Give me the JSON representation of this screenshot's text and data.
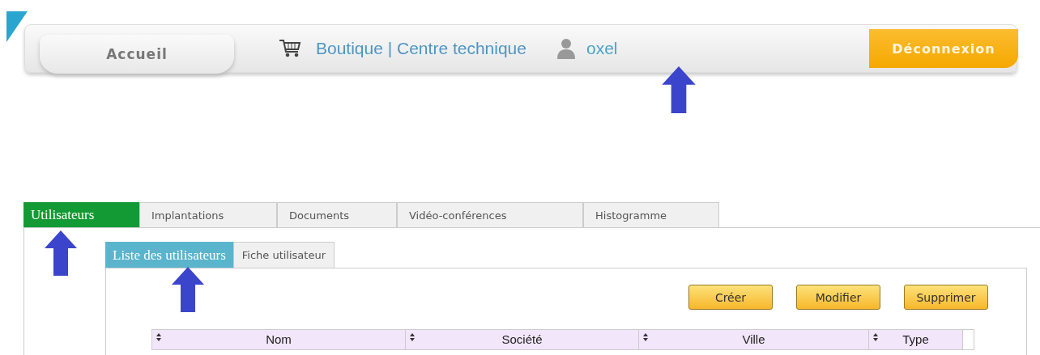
{
  "header": {
    "home": "Accueil",
    "shop": "Boutique | Centre technique",
    "user": "oxel",
    "logout": "Déconnexion"
  },
  "tabs": [
    {
      "label": "Utilisateurs",
      "selected": true
    },
    {
      "label": "Implantations",
      "selected": false
    },
    {
      "label": "Documents",
      "selected": false
    },
    {
      "label": "Vidéo-conférences",
      "selected": false
    },
    {
      "label": "Histogramme",
      "selected": false
    }
  ],
  "subtabs": [
    {
      "label": "Liste des utilisateurs",
      "selected": true
    },
    {
      "label": "Fiche utilisateur",
      "selected": false
    }
  ],
  "buttons": [
    "Créer",
    "Modifier",
    "Supprimer"
  ],
  "table": {
    "columns": [
      "Nom",
      "Société",
      "Ville",
      "Type"
    ]
  }
}
